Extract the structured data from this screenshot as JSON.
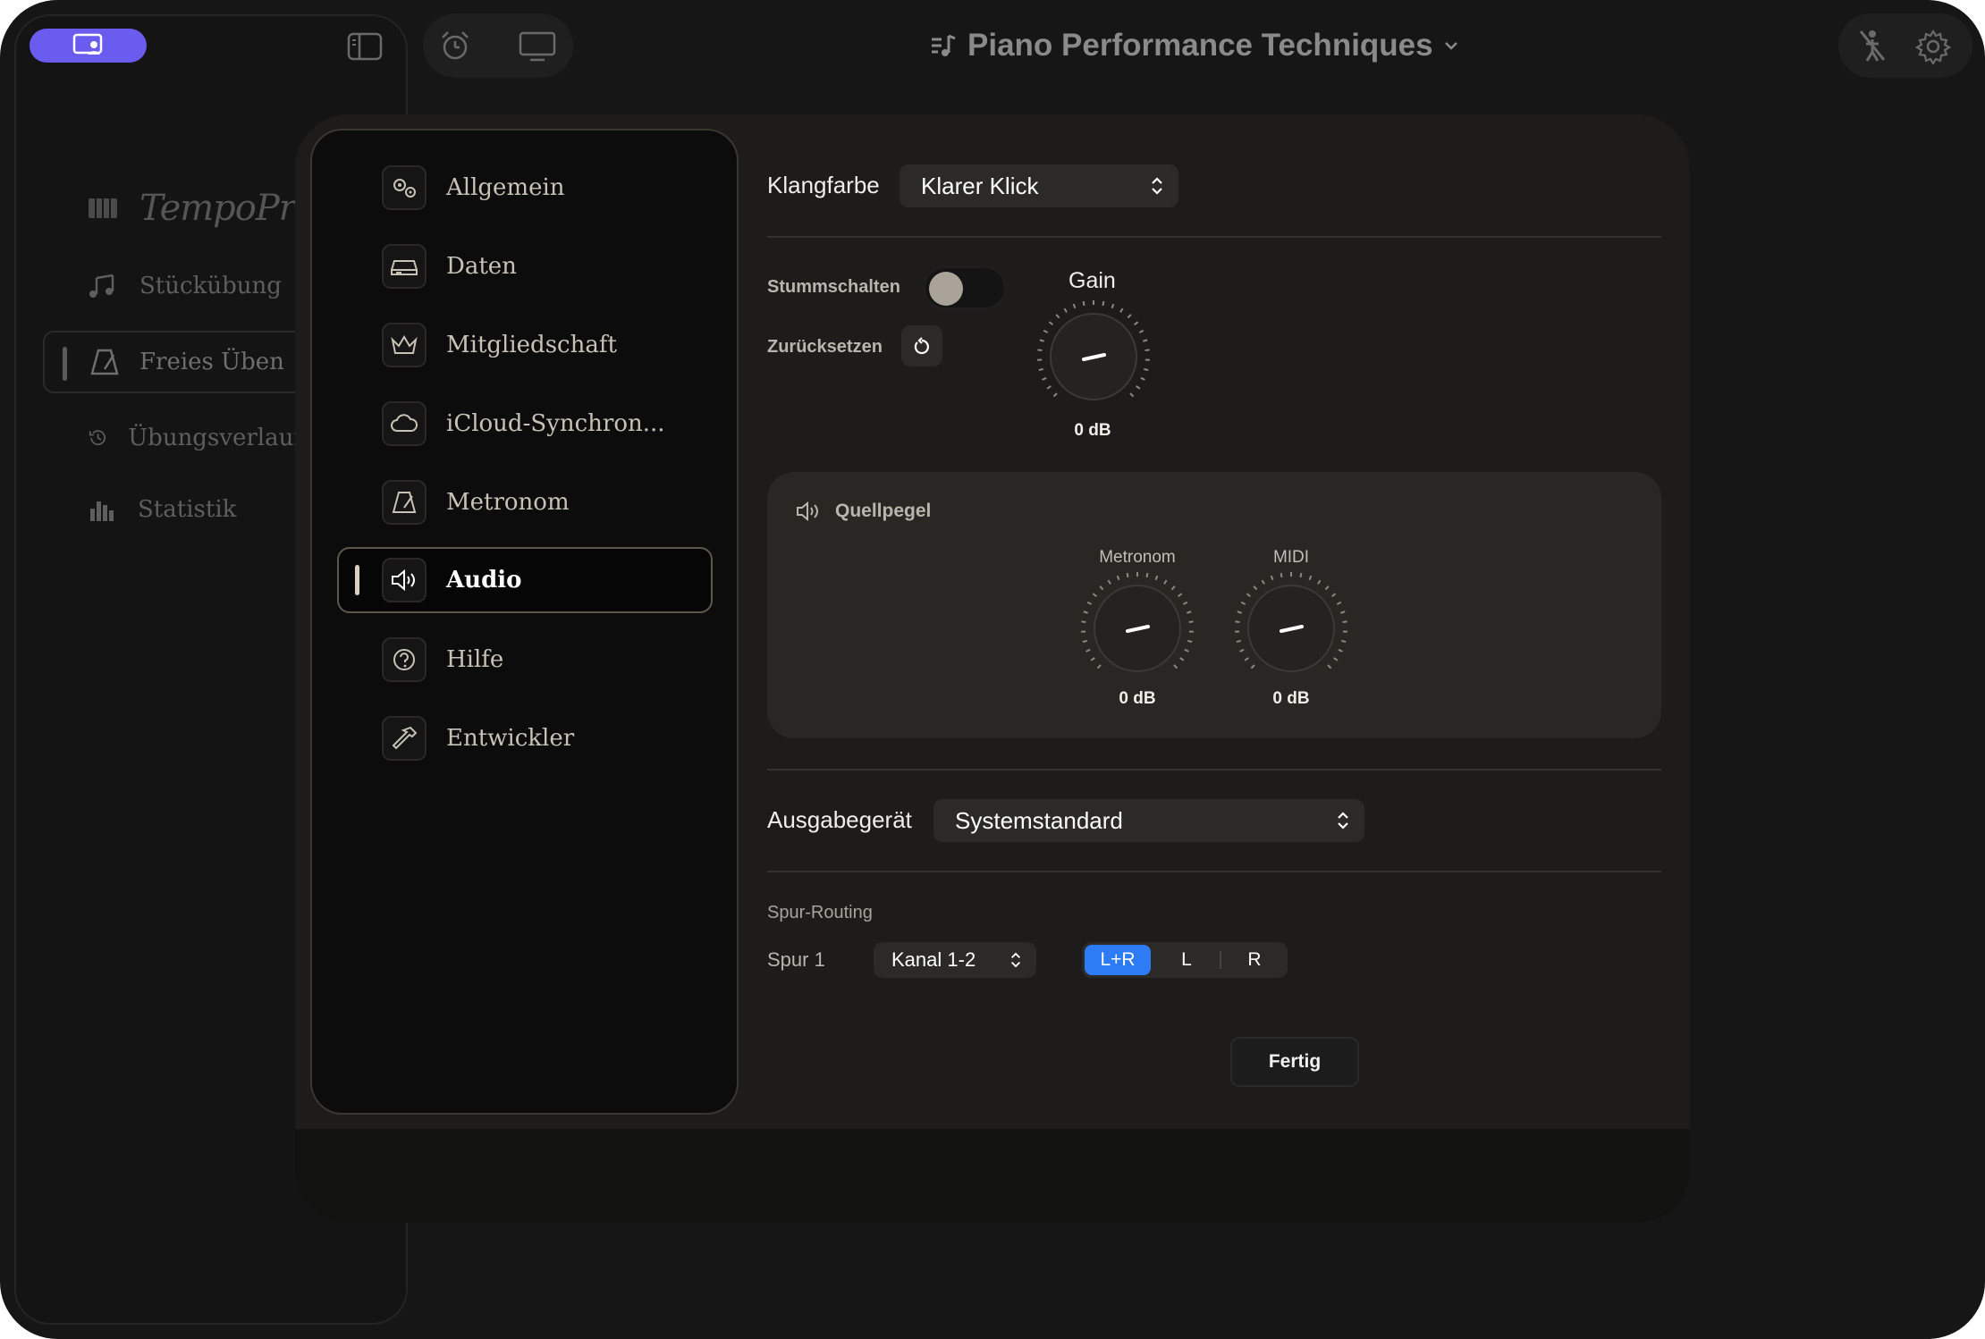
{
  "app": {
    "title": "Piano Performance Techniques",
    "brand": "TempoPro"
  },
  "background_nav": {
    "items": [
      {
        "label": "Stückübung",
        "icon": "music-notes-icon"
      },
      {
        "label": "Freies Üben",
        "icon": "metronome-icon",
        "active": true
      },
      {
        "label": "Übungsverlauf",
        "icon": "history-icon"
      },
      {
        "label": "Statistik",
        "icon": "bar-chart-icon"
      }
    ]
  },
  "settings_nav": {
    "items": [
      {
        "label": "Allgemein",
        "icon": "gears-icon"
      },
      {
        "label": "Daten",
        "icon": "drive-icon"
      },
      {
        "label": "Mitgliedschaft",
        "icon": "crown-icon"
      },
      {
        "label": "iCloud-Synchron...",
        "icon": "cloud-icon"
      },
      {
        "label": "Metronom",
        "icon": "metronome-icon"
      },
      {
        "label": "Audio",
        "icon": "speaker-icon",
        "active": true
      },
      {
        "label": "Hilfe",
        "icon": "help-icon"
      },
      {
        "label": "Entwickler",
        "icon": "hammer-icon"
      }
    ]
  },
  "audio": {
    "timbre_label": "Klangfarbe",
    "timbre_value": "Klarer Klick",
    "mute_label": "Stummschalten",
    "mute_on": false,
    "reset_label": "Zurücksetzen",
    "gain_label": "Gain",
    "gain_value": "0 dB",
    "source_levels": {
      "title": "Quellpegel",
      "metronome_label": "Metronom",
      "metronome_value": "0 dB",
      "midi_label": "MIDI",
      "midi_value": "0 dB"
    },
    "output_label": "Ausgabegerät",
    "output_value": "Systemstandard",
    "routing_title": "Spur-Routing",
    "track_label": "Spur 1",
    "channel_value": "Kanal 1-2",
    "routing_options": [
      "L+R",
      "L",
      "R"
    ],
    "routing_selected": "L+R"
  },
  "footer": {
    "done_label": "Fertig"
  },
  "colors": {
    "accent_purple": "#6b5cf0",
    "accent_blue": "#2e7bf6",
    "panel": "#1d1c1a"
  }
}
